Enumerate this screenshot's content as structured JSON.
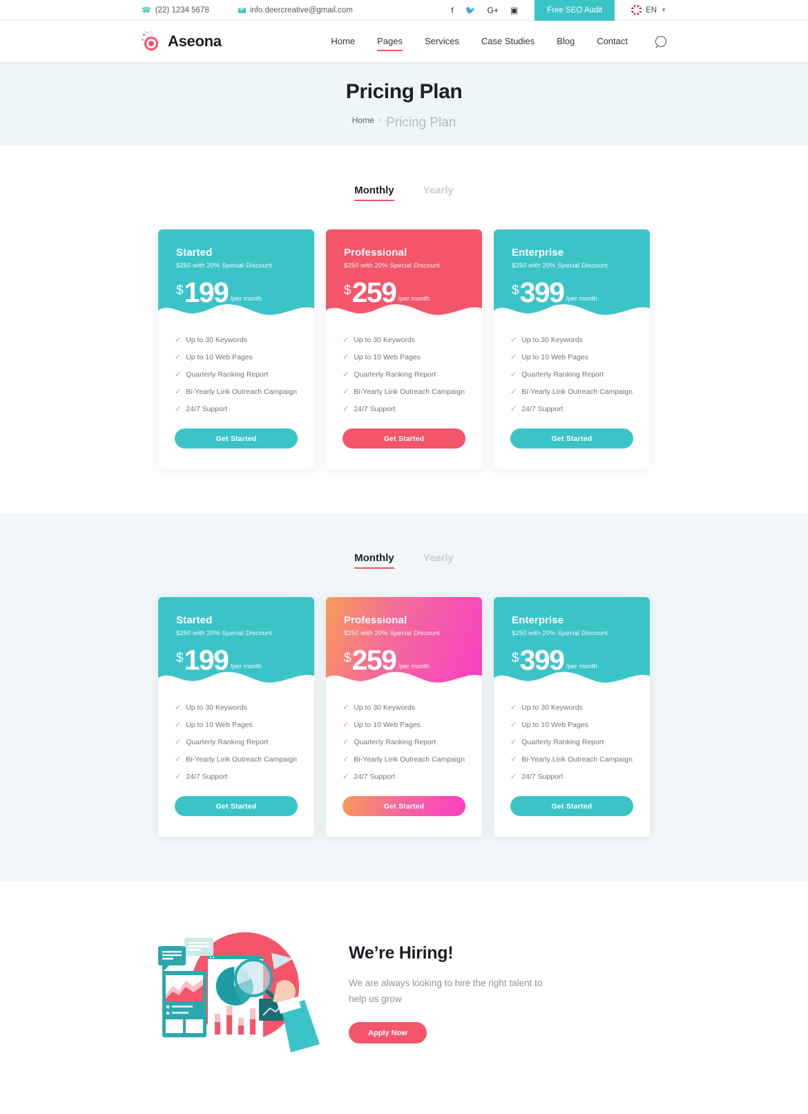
{
  "topbar": {
    "phone": "(22) 1234 5678",
    "email": "info.deercreative@gmail.com",
    "phone_icon": "phone-icon",
    "mail_icon": "mail-icon",
    "socials": [
      {
        "name": "facebook-icon",
        "glyph": "f"
      },
      {
        "name": "twitter-icon",
        "glyph": "✉"
      },
      {
        "name": "googleplus-icon",
        "glyph": "G+"
      },
      {
        "name": "instagram-icon",
        "glyph": "▣"
      }
    ],
    "cta_label": "Free SEO Audit",
    "language": "EN",
    "language_caret": "⌄",
    "flag": "uk-flag-icon"
  },
  "nav": {
    "brand": "Aseona",
    "items": [
      {
        "label": "Home",
        "active": false
      },
      {
        "label": "Pages",
        "active": true
      },
      {
        "label": "Services",
        "active": false
      },
      {
        "label": "Case Studies",
        "active": false
      },
      {
        "label": "Blog",
        "active": false
      },
      {
        "label": "Contact",
        "active": false
      }
    ],
    "search_icon": "search-icon"
  },
  "hero": {
    "title": "Pricing Plan",
    "breadcrumb_home": "Home",
    "breadcrumb_sep": "›",
    "breadcrumb_current": "Pricing Plan"
  },
  "pricing": {
    "toggle": {
      "monthly": "Monthly",
      "yearly": "Yearly"
    },
    "features": [
      "Up to 30 Keywords",
      "Up to 10 Web Pages",
      "Quarterly Ranking Report",
      "Bi-Yearly Link Outreach Campaign",
      "24/7 Support"
    ],
    "check_glyph": "✓",
    "cta_label": "Get Started",
    "plans": [
      {
        "name": "Started",
        "sub": "$250 with 20% Special Discount",
        "currency": "$",
        "amount": "199",
        "period": "/per month"
      },
      {
        "name": "Professional",
        "sub": "$250 with 20% Special Discount",
        "currency": "$",
        "amount": "259",
        "period": "/per month"
      },
      {
        "name": "Enterprise",
        "sub": "$250 with 20% Special Discount",
        "currency": "$",
        "amount": "399",
        "period": "/per month"
      }
    ]
  },
  "hiring": {
    "title": "We’re Hiring!",
    "body": "We are always looking to hire the right talent to help us grow",
    "cta_label": "Apply Now",
    "illustration": "analytics-illustration"
  },
  "colors": {
    "teal": "#3bc4c8",
    "pink": "#f4556a",
    "highlight": "#fbc0c9",
    "hero_bg": "#eff6f7",
    "section_bg": "#f1f7f8",
    "gradient_start": "#f99c57",
    "gradient_end": "#f83fc4",
    "muted_text": "#8d959a"
  }
}
